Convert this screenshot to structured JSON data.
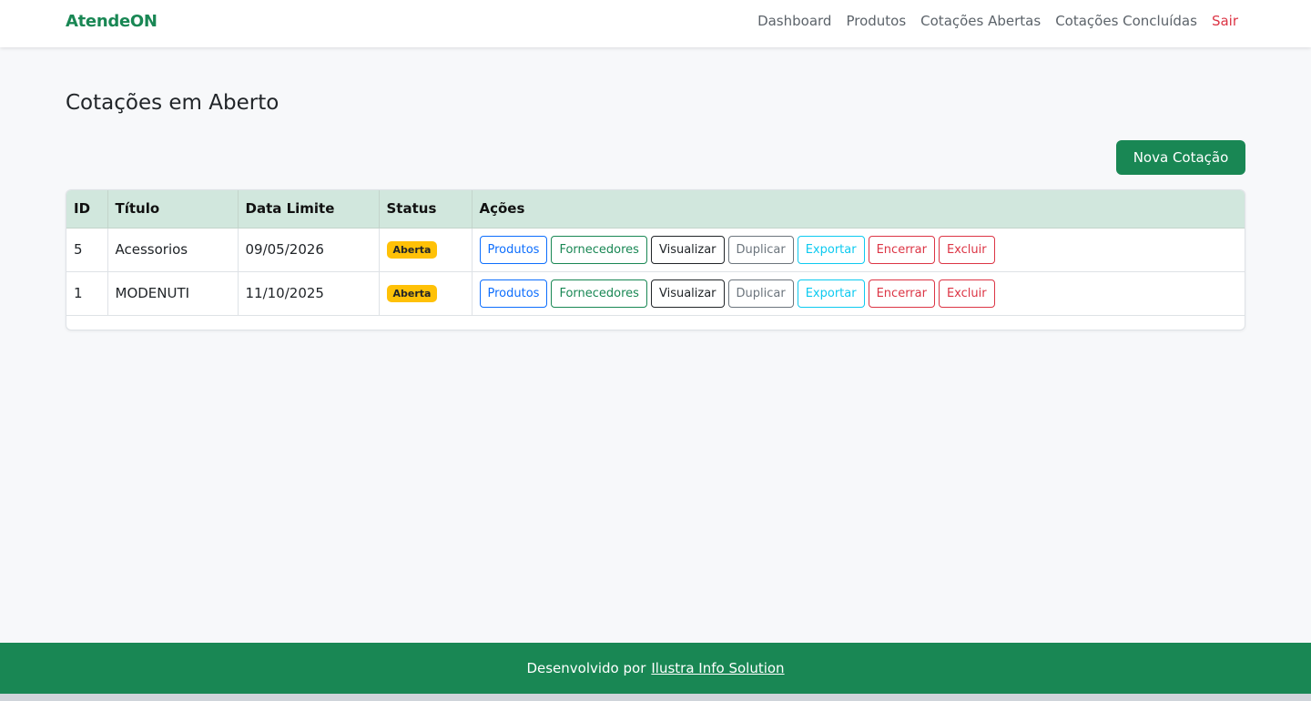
{
  "brand": "AtendeON",
  "nav": {
    "items": [
      {
        "label": "Dashboard"
      },
      {
        "label": "Produtos"
      },
      {
        "label": "Cotações Abertas"
      },
      {
        "label": "Cotações Concluídas"
      }
    ],
    "logout": "Sair"
  },
  "page": {
    "title": "Cotações em Aberto",
    "new_button": "Nova Cotação"
  },
  "table": {
    "headers": {
      "id": "ID",
      "title": "Título",
      "date": "Data Limite",
      "status": "Status",
      "actions": "Ações"
    },
    "action_labels": {
      "produtos": "Produtos",
      "fornecedores": "Fornecedores",
      "visualizar": "Visualizar",
      "duplicar": "Duplicar",
      "exportar": "Exportar",
      "encerrar": "Encerrar",
      "excluir": "Excluir"
    },
    "rows": [
      {
        "id": "5",
        "title": "Acessorios",
        "date": "09/05/2026",
        "status": "Aberta"
      },
      {
        "id": "1",
        "title": "MODENUTI",
        "date": "11/10/2025",
        "status": "Aberta"
      }
    ]
  },
  "footer": {
    "text": "Desenvolvido por",
    "link": "Ilustra Info Solution"
  },
  "colors": {
    "primary_green": "#198754",
    "header_green": "#d1e7dd",
    "badge_yellow": "#ffc107",
    "danger": "#dc3545"
  }
}
